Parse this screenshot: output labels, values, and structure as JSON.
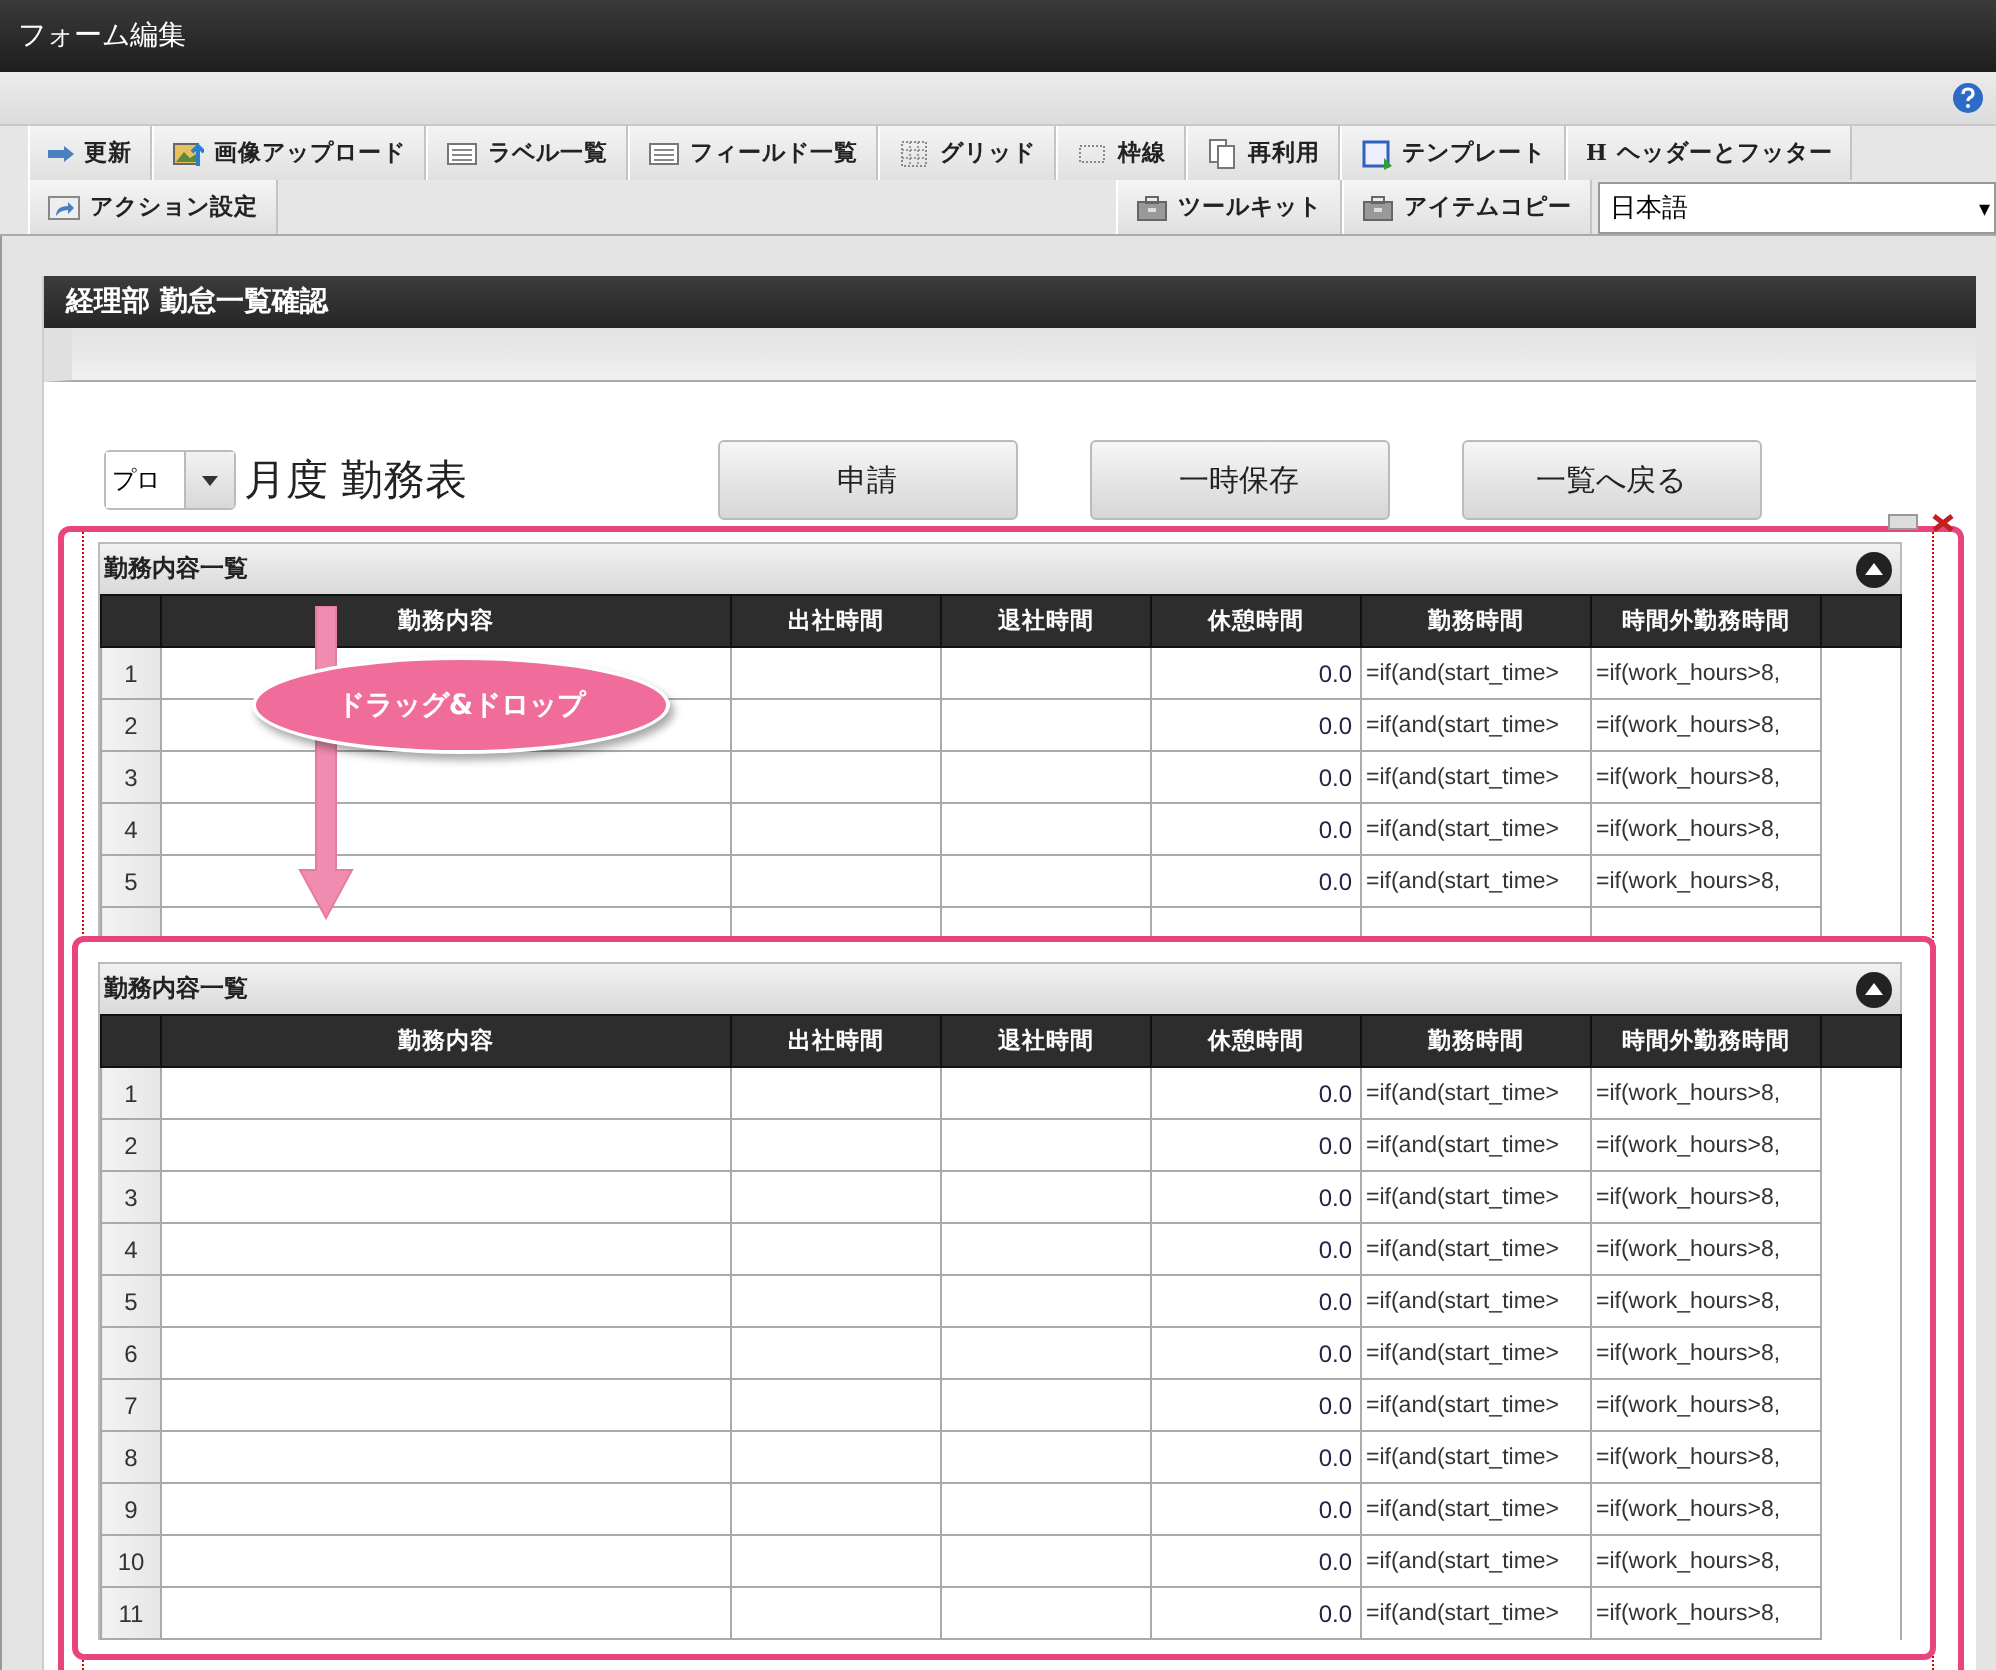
{
  "window": {
    "title": "フォーム編集"
  },
  "toolbar": {
    "row_1": [
      {
        "label": "更新"
      },
      {
        "label": "画像アップロード"
      },
      {
        "label": "ラベル一覧"
      },
      {
        "label": "フィールド一覧"
      },
      {
        "label": "グリッド"
      },
      {
        "label": "枠線"
      },
      {
        "label": "再利用"
      },
      {
        "label": "テンプレート"
      },
      {
        "label": "ヘッダーとフッター",
        "glyph": "H"
      }
    ],
    "row_2_left": [
      {
        "label": "アクション設定"
      }
    ],
    "row_2_right": [
      {
        "label": "ツールキット"
      },
      {
        "label": "アイテムコピー"
      }
    ],
    "language": {
      "value": "日本語",
      "caret": "▾"
    }
  },
  "form": {
    "title": "経理部 勤怠一覧確認",
    "month_select": {
      "value": "プロ"
    },
    "heading": "月度 勤務表",
    "buttons": [
      "申請",
      "一時保存",
      "一覧へ戻る"
    ],
    "table_panel": {
      "title": "勤務内容一覧",
      "columns": [
        "勤務内容",
        "出社時間",
        "退社時間",
        "休憩時間",
        "勤務時間",
        "時間外勤務時間"
      ],
      "rows": [
        {
          "no": "1",
          "break_time": "0.0",
          "work_hours": "=if(and(start_time>",
          "overtime": "=if(work_hours>8,"
        },
        {
          "no": "2",
          "break_time": "0.0",
          "work_hours": "=if(and(start_time>",
          "overtime": "=if(work_hours>8,"
        },
        {
          "no": "3",
          "break_time": "0.0",
          "work_hours": "=if(and(start_time>",
          "overtime": "=if(work_hours>8,"
        },
        {
          "no": "4",
          "break_time": "0.0",
          "work_hours": "=if(and(start_time>",
          "overtime": "=if(work_hours>8,"
        },
        {
          "no": "5",
          "break_time": "0.0",
          "work_hours": "=if(and(start_time>",
          "overtime": "=if(work_hours>8,"
        }
      ]
    },
    "drag_callout": "ドラッグ&ドロップ",
    "drag_preview": {
      "title": "勤務内容一覧",
      "columns": [
        "勤務内容",
        "出社時間",
        "退社時間",
        "休憩時間",
        "勤務時間",
        "時間外勤務時間"
      ],
      "rows": [
        {
          "no": "1",
          "break_time": "0.0",
          "work_hours": "=if(and(start_time>",
          "overtime": "=if(work_hours>8,"
        },
        {
          "no": "2",
          "break_time": "0.0",
          "work_hours": "=if(and(start_time>",
          "overtime": "=if(work_hours>8,"
        },
        {
          "no": "3",
          "break_time": "0.0",
          "work_hours": "=if(and(start_time>",
          "overtime": "=if(work_hours>8,"
        },
        {
          "no": "4",
          "break_time": "0.0",
          "work_hours": "=if(and(start_time>",
          "overtime": "=if(work_hours>8,"
        },
        {
          "no": "5",
          "break_time": "0.0",
          "work_hours": "=if(and(start_time>",
          "overtime": "=if(work_hours>8,"
        },
        {
          "no": "6",
          "break_time": "0.0",
          "work_hours": "=if(and(start_time>",
          "overtime": "=if(work_hours>8,"
        },
        {
          "no": "7",
          "break_time": "0.0",
          "work_hours": "=if(and(start_time>",
          "overtime": "=if(work_hours>8,"
        },
        {
          "no": "8",
          "break_time": "0.0",
          "work_hours": "=if(and(start_time>",
          "overtime": "=if(work_hours>8,"
        },
        {
          "no": "9",
          "break_time": "0.0",
          "work_hours": "=if(and(start_time>",
          "overtime": "=if(work_hours>8,"
        },
        {
          "no": "10",
          "break_time": "0.0",
          "work_hours": "=if(and(start_time>",
          "overtime": "=if(work_hours>8,"
        },
        {
          "no": "11",
          "break_time": "0.0",
          "work_hours": "=if(and(start_time>",
          "overtime": "=if(work_hours>8,"
        }
      ]
    }
  }
}
